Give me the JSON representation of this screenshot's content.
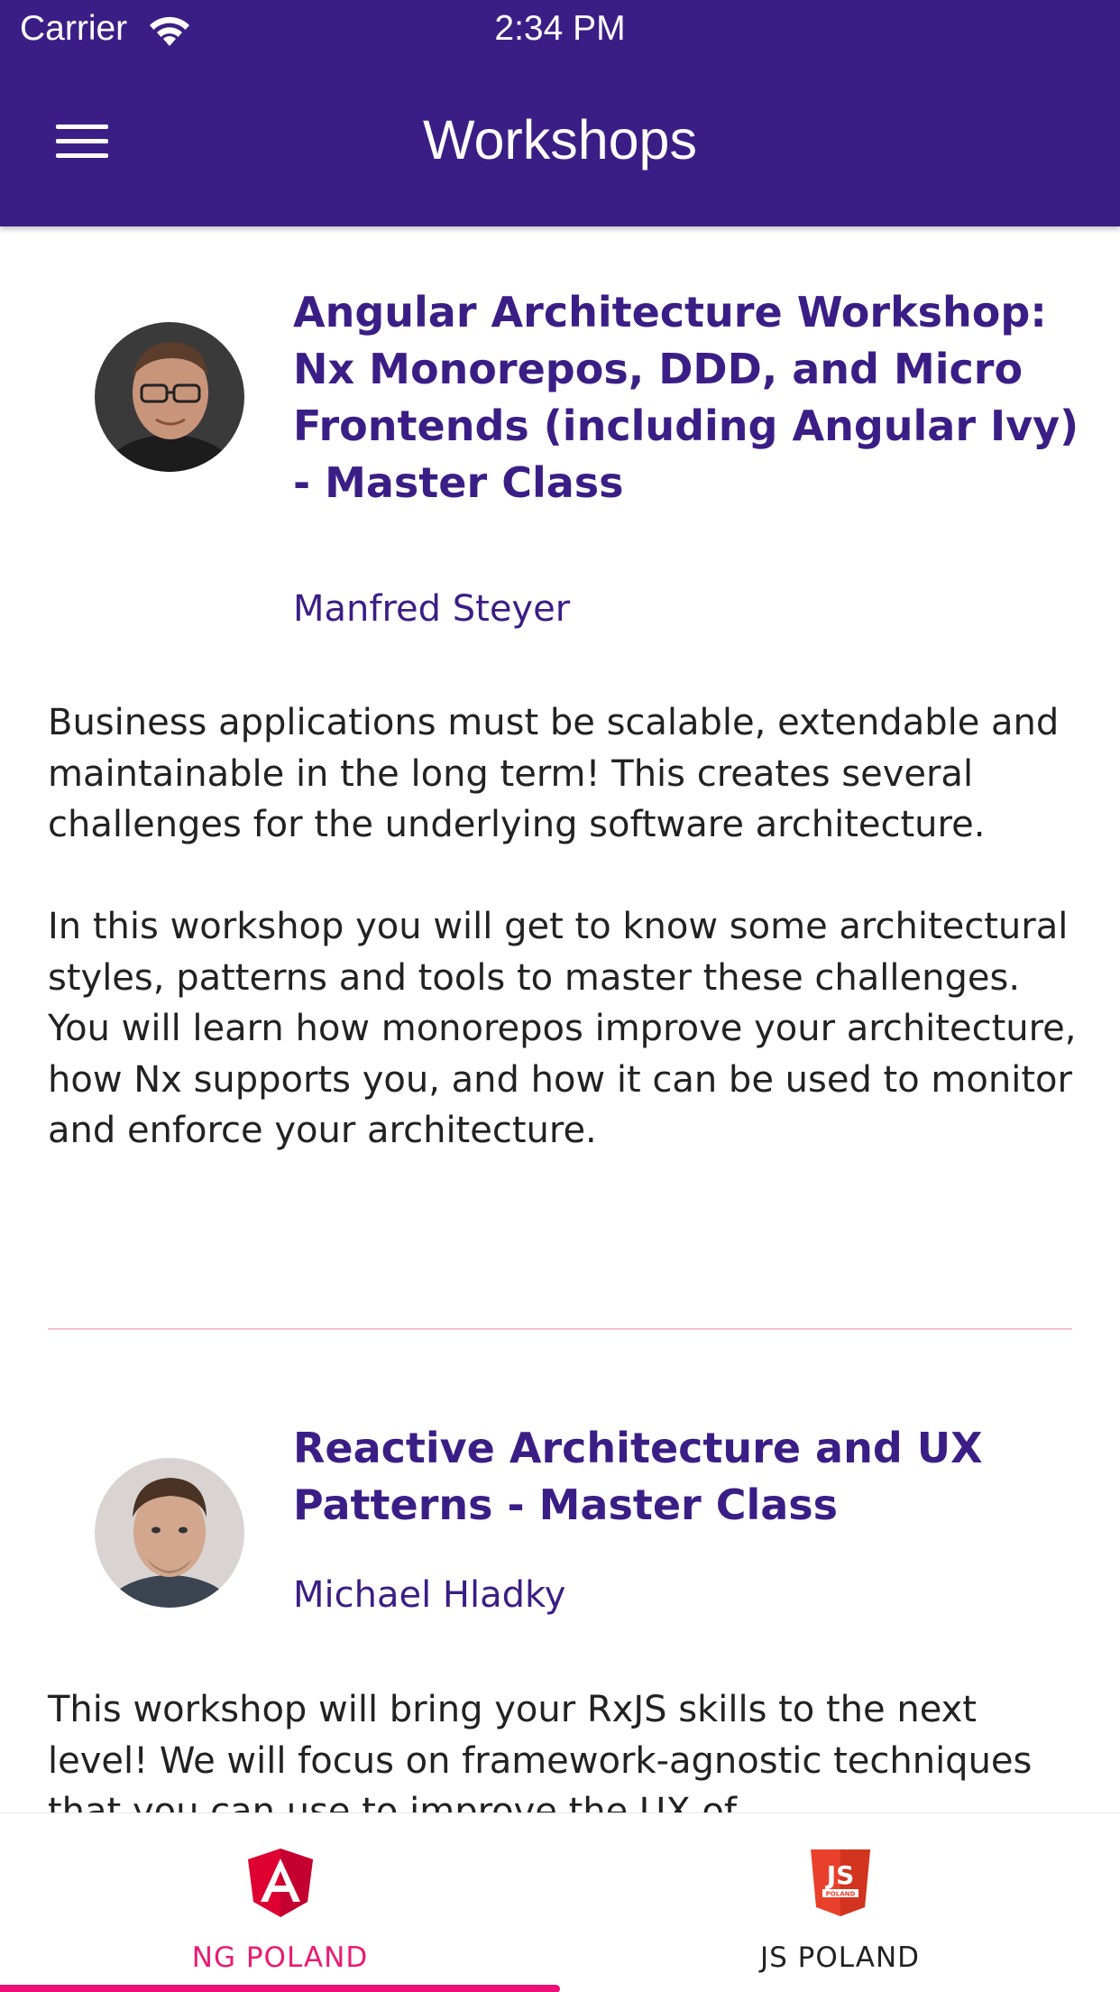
{
  "status_bar": {
    "carrier": "Carrier",
    "time": "2:34 PM"
  },
  "header": {
    "title": "Workshops"
  },
  "workshops": [
    {
      "title": "Angular Architecture Workshop: Nx Monorepos, DDD, and Micro Frontends (including Angular Ivy) - Master Class",
      "speaker": "Manfred Steyer",
      "description": [
        "Business applications must be scalable, extendable and maintainable in the long term! This creates several challenges for the underlying software architecture.",
        "In this workshop you will get to know some architectural styles, patterns and tools to master these challenges. You will learn how monorepos improve your architecture, how Nx supports you, and how it can be used to monitor and enforce your architecture."
      ]
    },
    {
      "title": "Reactive Architecture and UX Patterns - Master Class",
      "speaker": "Michael Hladky",
      "description": [
        "This workshop will bring your RxJS skills to the next level! We will focus on framework-agnostic techniques that you can use to improve the UX of"
      ]
    }
  ],
  "tabs": [
    {
      "label": "NG POLAND",
      "icon": "angular-shield-icon",
      "active": true
    },
    {
      "label": "JS POLAND",
      "icon": "js-poland-shield-icon",
      "active": false
    }
  ],
  "colors": {
    "header_bg": "#3b1e85",
    "title_text": "#3b1e85",
    "active_tab": "#ea1b73",
    "angular_red": "#dd0031",
    "js_shield": "#e8402b",
    "divider": "#f6c1d2"
  }
}
